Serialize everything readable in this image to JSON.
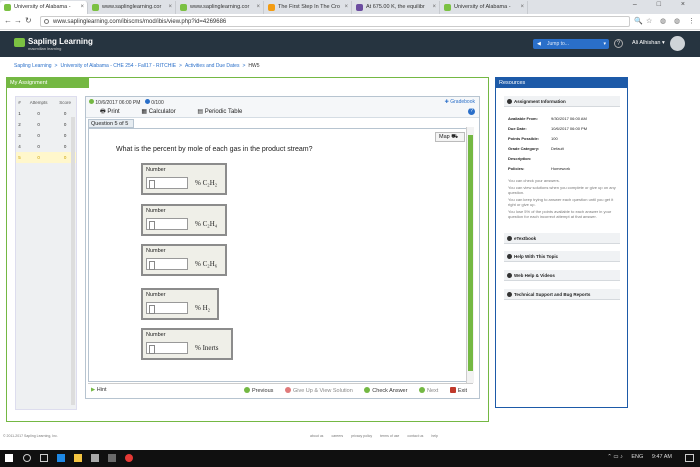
{
  "browser": {
    "tabs": [
      {
        "label": "University of Alabama -",
        "color": "#7bc142",
        "active": true
      },
      {
        "label": "www.saplinglearning.cor",
        "color": "#7bc142",
        "active": false
      },
      {
        "label": "www.saplinglearning.cor",
        "color": "#7bc142",
        "active": false
      },
      {
        "label": "The First Step In The Cro",
        "color": "#f39c12",
        "active": false
      },
      {
        "label": "At 675.00 K, the equilibr",
        "color": "#6c4da0",
        "active": false
      },
      {
        "label": "University of Alabama -",
        "color": "#7bc142",
        "active": false
      }
    ],
    "url": "www.saplinglearning.com/ibiscms/mod/ibis/view.php?id=4269686",
    "window_controls": "– □ ×"
  },
  "header": {
    "brand": "Sapling Learning",
    "brand_sub": "macmillan learning",
    "jump_label": "Jump to...",
    "help": "?",
    "user": "Ali Alhishan ▾"
  },
  "breadcrumb": [
    "Sapling Learning",
    ">",
    "University of Alabama - CHE 254 - Fall17 - RITCHIE",
    ">",
    "Activities and Due Dates",
    ">",
    "HW5"
  ],
  "my_assignment": {
    "title": "My Assignment",
    "columns": [
      "#",
      "Attempts",
      "Score"
    ],
    "rows": [
      [
        "1",
        "0",
        "0"
      ],
      [
        "2",
        "0",
        "0"
      ],
      [
        "3",
        "0",
        "0"
      ],
      [
        "4",
        "0",
        "0"
      ],
      [
        "5",
        "0",
        "0"
      ]
    ],
    "selected_row": 4
  },
  "question": {
    "meta": "10/6/2017 06:00 PM",
    "score": "0/100",
    "tools": [
      "Print",
      "Calculator",
      "Periodic Table"
    ],
    "gradebook": "Gradebook",
    "tab": "Question 5 of 5",
    "map": "Map",
    "prompt": "What is the percent by mole of each gas in the product stream?",
    "inputs": [
      {
        "label": "Number",
        "unit": "% C₂H₂"
      },
      {
        "label": "Number",
        "unit": "% C₂H₄"
      },
      {
        "label": "Number",
        "unit": "% C₂H₆"
      },
      {
        "label": "Number",
        "unit": "% H₂"
      },
      {
        "label": "Number",
        "unit": "% Inerts"
      }
    ],
    "hint": "Hint",
    "footer_buttons": [
      "Previous",
      "Give Up & View Solution",
      "Check Answer",
      "Next",
      "Exit"
    ]
  },
  "resources": {
    "title": "Resources",
    "sections": [
      "Assignment Information",
      "eTextbook",
      "Help With This Topic",
      "Web Help & Videos",
      "Technical Support and Bug Reports"
    ],
    "info": [
      {
        "k": "Available From:",
        "v": "9/30/2017 06:00 AM"
      },
      {
        "k": "Due Date:",
        "v": "10/6/2017 06:00 PM"
      },
      {
        "k": "Points Possible:",
        "v": "100"
      },
      {
        "k": "Grade Category:",
        "v": "Default"
      },
      {
        "k": "Description:",
        "v": ""
      },
      {
        "k": "Policies:",
        "v": "Homework"
      }
    ],
    "notes": [
      "You can check your answers.",
      "You can view solutions when you complete or give up on any question.",
      "You can keep trying to answer each question until you get it right or give up.",
      "You lose 5% of the points available to each answer in your question for each incorrect attempt at that answer."
    ]
  },
  "footer": {
    "copyright": "© 2011-2017 Sapling Learning, Inc.",
    "links": [
      "about us",
      "careers",
      "privacy policy",
      "terms of use",
      "contact us",
      "help"
    ]
  },
  "taskbar": {
    "lang": "ENG",
    "time": "9:47 AM"
  }
}
